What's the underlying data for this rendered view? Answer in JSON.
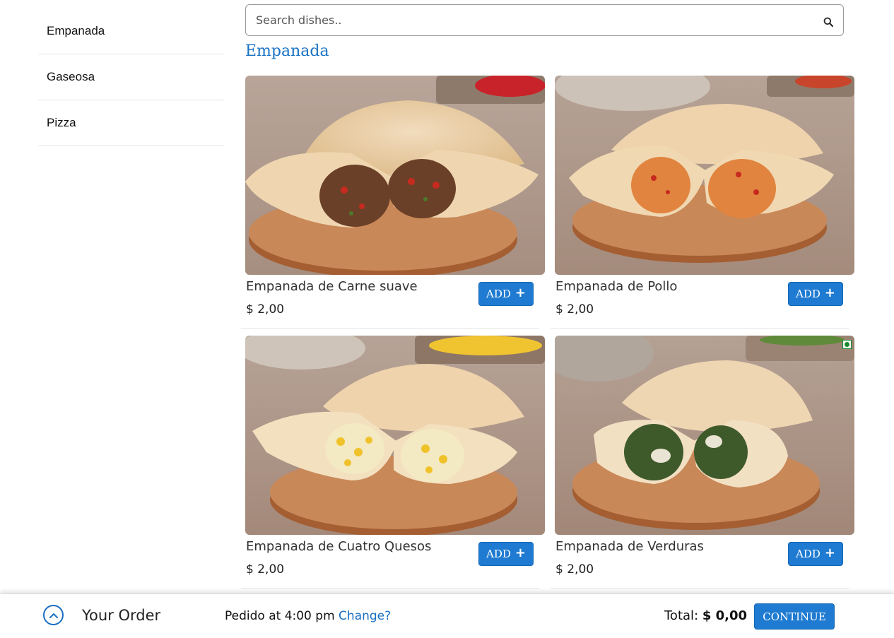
{
  "sidebar": {
    "categories": [
      {
        "label": "Empanada"
      },
      {
        "label": "Gaseosa"
      },
      {
        "label": "Pizza"
      }
    ]
  },
  "search": {
    "placeholder": "Search dishes..",
    "value": "",
    "icon": "search-icon"
  },
  "section": {
    "title": "Empanada"
  },
  "dishes": [
    {
      "name": "Empanada de Carne suave",
      "price": "$ 2,00",
      "add_label": "ADD",
      "add_icon": "+",
      "filling": "meat",
      "veg": false
    },
    {
      "name": "Empanada de Pollo",
      "price": "$ 2,00",
      "add_label": "ADD",
      "add_icon": "+",
      "filling": "chicken",
      "veg": false
    },
    {
      "name": "Empanada de Cuatro Quesos",
      "price": "$ 2,00",
      "add_label": "ADD",
      "add_icon": "+",
      "filling": "cheese-corn",
      "veg": false
    },
    {
      "name": "Empanada de Verduras",
      "price": "$ 2,00",
      "add_label": "ADD",
      "add_icon": "+",
      "filling": "spinach",
      "veg": true
    }
  ],
  "order_bar": {
    "title": "Your Order",
    "toggle_icon": "chevron-up-icon",
    "pedido_text": "Pedido at 4:00 pm",
    "change_label": "Change?",
    "total_label": "Total:",
    "total_value": "$ 0,00",
    "continue_label": "CONTINUE"
  },
  "colors": {
    "accent": "#1f7bd1",
    "link": "#1a6fc2",
    "veg_badge": "#1a8a2a"
  }
}
